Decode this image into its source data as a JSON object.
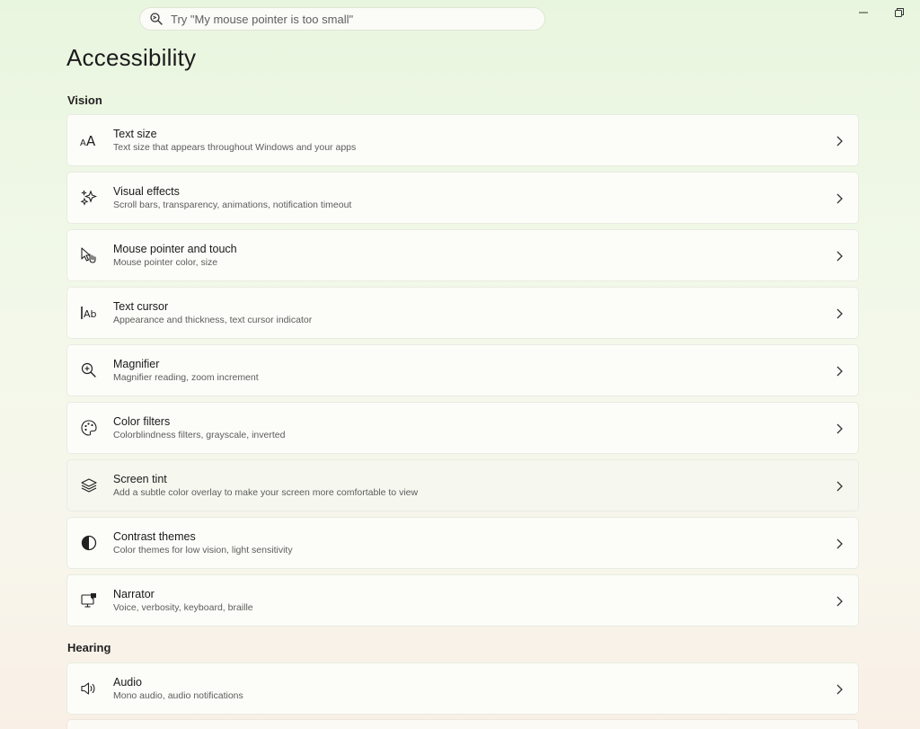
{
  "search": {
    "placeholder": "Try \"My mouse pointer is too small\"",
    "icon": "search-icon"
  },
  "window_controls": {
    "minimize_icon": "minimize-icon",
    "restore_icon": "restore-icon"
  },
  "page": {
    "title": "Accessibility"
  },
  "sections": {
    "vision": {
      "title": "Vision",
      "items": [
        {
          "key": "text-size",
          "icon": "text-size-icon",
          "label": "Text size",
          "description": "Text size that appears throughout Windows and your apps"
        },
        {
          "key": "visual-effects",
          "icon": "sparkle-icon",
          "label": "Visual effects",
          "description": "Scroll bars, transparency, animations, notification timeout"
        },
        {
          "key": "mouse-pointer",
          "icon": "mouse-pointer-icon",
          "label": "Mouse pointer and touch",
          "description": "Mouse pointer color, size"
        },
        {
          "key": "text-cursor",
          "icon": "text-cursor-icon",
          "label": "Text cursor",
          "description": "Appearance and thickness, text cursor indicator"
        },
        {
          "key": "magnifier",
          "icon": "magnifier-icon",
          "label": "Magnifier",
          "description": "Magnifier reading, zoom increment"
        },
        {
          "key": "color-filters",
          "icon": "palette-icon",
          "label": "Color filters",
          "description": "Colorblindness filters, grayscale, inverted"
        },
        {
          "key": "screen-tint",
          "icon": "layers-icon",
          "label": "Screen tint",
          "description": "Add a subtle color overlay to make your screen more comfortable to view"
        },
        {
          "key": "contrast-themes",
          "icon": "contrast-icon",
          "label": "Contrast themes",
          "description": "Color themes for low vision, light sensitivity"
        },
        {
          "key": "narrator",
          "icon": "narrator-icon",
          "label": "Narrator",
          "description": "Voice, verbosity, keyboard, braille"
        }
      ]
    },
    "hearing": {
      "title": "Hearing",
      "items": [
        {
          "key": "audio",
          "icon": "speaker-icon",
          "label": "Audio",
          "description": "Mono audio, audio notifications"
        }
      ]
    }
  }
}
